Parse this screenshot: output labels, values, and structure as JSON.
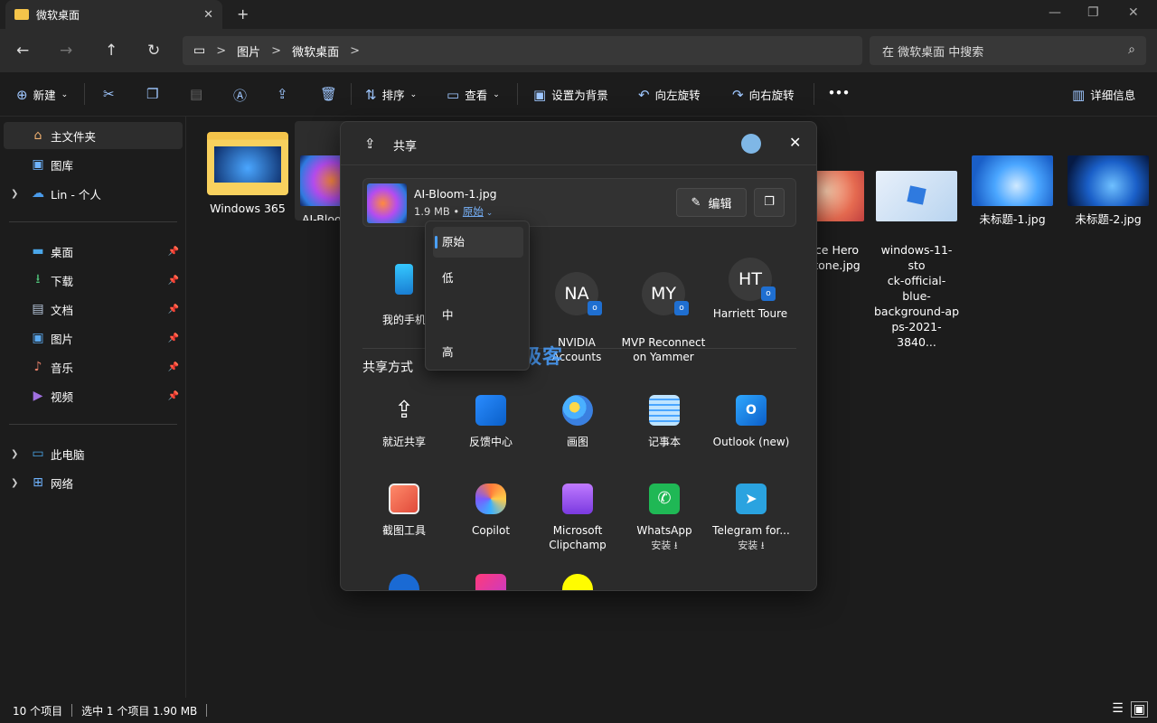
{
  "window": {
    "tab_title": "微软桌面",
    "new_tab": "+",
    "minimize": "—",
    "maximize": "❐",
    "close": "✕"
  },
  "nav": {
    "back": "←",
    "forward": "→",
    "up": "↑",
    "refresh": "↻",
    "breadcrumb": [
      "图片",
      "微软桌面"
    ],
    "breadcrumb_sep": ">",
    "search_placeholder": "在 微软桌面 中搜索"
  },
  "toolbar": {
    "new": "新建",
    "sort": "排序",
    "view": "查看",
    "set_background": "设置为背景",
    "rotate_left": "向左旋转",
    "rotate_right": "向右旋转",
    "more": "•••",
    "details": "详细信息"
  },
  "sidebar": {
    "home": "主文件夹",
    "gallery": "图库",
    "onedrive": "Lin - 个人",
    "desktop": "桌面",
    "downloads": "下载",
    "documents": "文档",
    "pictures": "图片",
    "music": "音乐",
    "videos": "视频",
    "thispc": "此电脑",
    "network": "网络"
  },
  "files": {
    "f1": "Windows 365",
    "f2": "AI-Bloo",
    "f3": "ce Hero\ntone.jpg",
    "f4": "windows-11-sto\nck-official-blue-\nbackground-ap\nps-2021-3840...",
    "f5": "未标题-1.jpg",
    "f6": "未标题-2.jpg"
  },
  "status": {
    "count": "10 个项目",
    "selection": "选中 1 个项目  1.90 MB"
  },
  "share": {
    "title": "共享",
    "file_name": "AI-Bloom-1.jpg",
    "file_size": "1.9 MB •",
    "quality": "原始",
    "edit": "编辑",
    "contacts": [
      {
        "initials": "",
        "name": "我的手机"
      },
      {
        "initials": "NA",
        "name": "NVIDIA\nAccounts"
      },
      {
        "initials": "MY",
        "name": "MVP Reconnect\non Yammer"
      },
      {
        "initials": "HT",
        "name": "Harriett Toure"
      }
    ],
    "share_methods": "共享方式",
    "apps": [
      {
        "name": "就近共享"
      },
      {
        "name": "反馈中心"
      },
      {
        "name": "画图"
      },
      {
        "name": "记事本"
      },
      {
        "name": "Outlook (new)"
      },
      {
        "name": "截图工具"
      },
      {
        "name": "Copilot"
      },
      {
        "name": "Microsoft\nClipchamp"
      },
      {
        "name": "WhatsApp",
        "sub": "安装 ⭳"
      },
      {
        "name": "Telegram for...",
        "sub": "安装 ⭳"
      }
    ],
    "watermark": "系统极客"
  },
  "quality_menu": [
    "原始",
    "低",
    "中",
    "高"
  ]
}
